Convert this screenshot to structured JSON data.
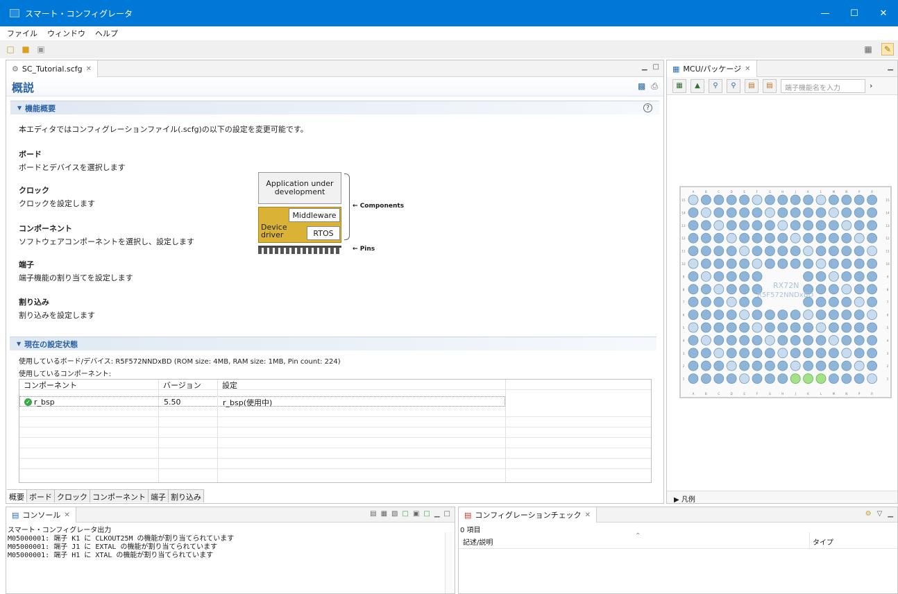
{
  "window": {
    "title": "スマート・コンフィグレータ"
  },
  "menu": [
    "ファイル",
    "ウィンドウ",
    "ヘルプ"
  ],
  "editor": {
    "tab_label": "SC_Tutorial.scfg",
    "page_title": "概説",
    "section_overview": "機能概要",
    "intro": "本エディタではコンフィグレーションファイル(.scfg)の以下の設定を変更可能です。",
    "items": [
      {
        "head": "ボード",
        "desc": "ボードとデバイスを選択します"
      },
      {
        "head": "クロック",
        "desc": "クロックを設定します"
      },
      {
        "head": "コンポーネント",
        "desc": "ソフトウェアコンポーネントを選択し、設定します"
      },
      {
        "head": "端子",
        "desc": "端子機能の割り当てを設定します"
      },
      {
        "head": "割り込み",
        "desc": "割り込みを設定します"
      }
    ],
    "diagram": {
      "app": "Application under development",
      "middleware": "Middleware",
      "device_driver": "Device driver",
      "rtos": "RTOS",
      "components": "Components",
      "pins": "Pins"
    },
    "section_status": "現在の設定状態",
    "board_device": "使用しているボード/デバイス:  R5F572NNDxBD (ROM size: 4MB, RAM size: 1MB, Pin count: 224)",
    "components_label": "使用しているコンポーネント:",
    "table": {
      "headers": [
        "コンポーネント",
        "バージョン",
        "設定"
      ],
      "rows": [
        {
          "component": "r_bsp",
          "version": "5.50",
          "setting": "r_bsp(使用中)"
        }
      ]
    },
    "bottom_tabs": [
      "概要",
      "ボード",
      "クロック",
      "コンポーネント",
      "端子",
      "割り込み"
    ]
  },
  "mcu": {
    "tab_label": "MCU/パッケージ",
    "search_placeholder": "端子機能名を入力",
    "legend": "凡例",
    "chip_label": "RX72N",
    "chip_part": "R5F572NNDxBD",
    "col_labels": [
      "A",
      "B",
      "C",
      "D",
      "E",
      "F",
      "G",
      "H",
      "J",
      "K",
      "L",
      "M",
      "N",
      "P",
      "R"
    ],
    "row_labels": [
      "15",
      "14",
      "13",
      "12",
      "11",
      "10",
      "9",
      "8",
      "7",
      "6",
      "5",
      "4",
      "3",
      "2",
      "1"
    ]
  },
  "console": {
    "tab_label": "コンソール",
    "subtitle": "スマート・コンフィグレータ出力",
    "lines": [
      "M05000001: 端子 K1 に CLKOUT25M の機能が割り当てられています",
      "M05000001: 端子 J1 に EXTAL の機能が割り当てられています",
      "M05000001: 端子 H1 に XTAL の機能が割り当てられています"
    ]
  },
  "config_check": {
    "tab_label": "コンフィグレーションチェック",
    "count": "0 項目",
    "headers": [
      "記述/説明",
      "タイプ"
    ]
  },
  "colors": {
    "accent": "#0078d7",
    "title_blue": "#2b62a5",
    "pin_fill": "#8fb6d8",
    "pin_assigned": "#a6e08a",
    "driver_gold": "#d9b236"
  }
}
